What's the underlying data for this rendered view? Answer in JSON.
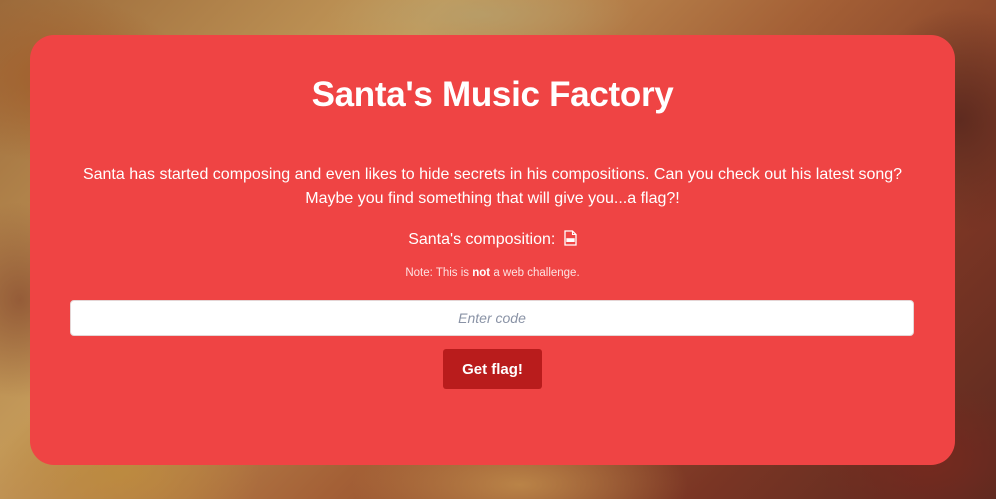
{
  "header": {
    "title": "Santa's Music Factory"
  },
  "main": {
    "description_line1": "Santa has started composing and even likes to hide secrets in his compositions. Can you check out his latest song?",
    "description_line2": "Maybe you find something that will give you...a flag?!",
    "composition_label": "Santa's composition:",
    "composition_icon": "pdf-file-icon",
    "note_prefix": "Note: This is ",
    "note_bold": "not",
    "note_suffix": " a web challenge."
  },
  "form": {
    "code_placeholder": "Enter code",
    "code_value": "",
    "submit_label": "Get flag!"
  },
  "colors": {
    "card": "#ef4444",
    "button": "#b91c1c",
    "text": "#ffffff"
  }
}
